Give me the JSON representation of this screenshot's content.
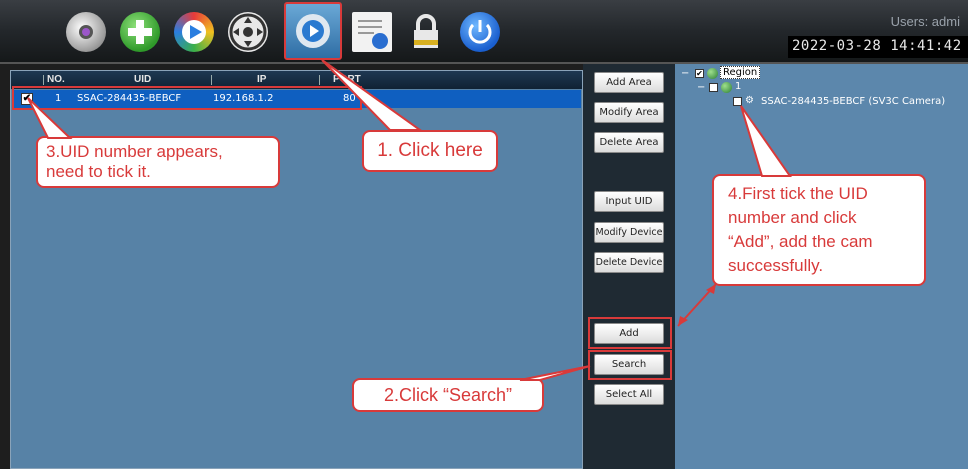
{
  "toolbar": {
    "icons": [
      "camera-icon",
      "add-icon",
      "playback-icon",
      "ptz-icon",
      "settings-icon",
      "log-icon",
      "lock-icon",
      "power-icon"
    ],
    "users_label": "Users: admi",
    "datetime": "2022-03-28  14:41:42"
  },
  "list": {
    "columns": [
      "NO.",
      "UID",
      "IP",
      "PORT"
    ],
    "rows": [
      {
        "no": "1",
        "uid": "SSAC-284435-BEBCF",
        "ip": "192.168.1.2",
        "port": "80",
        "checked": true
      }
    ]
  },
  "buttons": {
    "add_area": "Add Area",
    "modify_area": "Modify Area",
    "delete_area": "Delete Area",
    "input_uid": "Input UID",
    "modify_device": "Modify Device",
    "delete_device": "Delete Device",
    "add": "Add",
    "search": "Search",
    "select_all": "Select All"
  },
  "tree": {
    "root": "Region",
    "child": "1",
    "device": "SSAC-284435-BEBCF  (SV3C Camera)"
  },
  "annotations": {
    "step1": "1. Click here",
    "step2": "2.Click “Search”",
    "step3_line1": "3.UID number appears,",
    "step3_line2": "need to tick it.",
    "step4_line1": "4.First tick the UID",
    "step4_line2": "number and click",
    "step4_line3": "“Add”, add the cam",
    "step4_line4": "successfully."
  },
  "colors": {
    "annotation_red": "#d83a3a",
    "list_bg": "#5782a6",
    "selected_row": "#0f5fc0"
  }
}
